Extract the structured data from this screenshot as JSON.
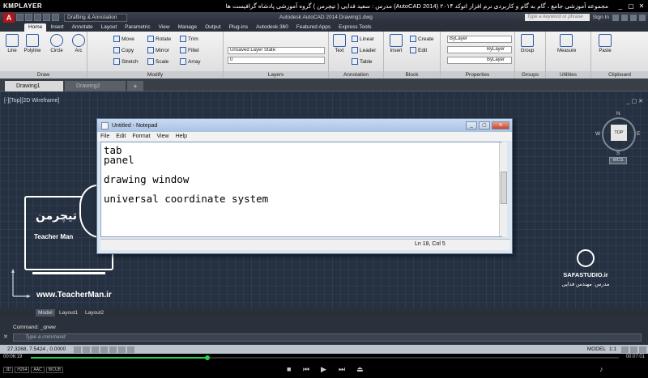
{
  "player": {
    "logo": "KMPLAYER",
    "title": "مجموعه آموزشی جامع ، گام به گام و کاربردی نرم افزار  اتوکد ۲۰۱۴ (AutoCAD 2014)  مدرس : سعید فدایی ( تیچرمن ) گروه آموزشی پادشاه گرافیست ها",
    "controls": [
      "_",
      "▢",
      "✕"
    ],
    "time_current": "00:06:19",
    "time_total": "00:07:01",
    "progress": 0.3,
    "tags": [
      "3D",
      "H264",
      "AAC",
      "BICUB"
    ]
  },
  "autocad": {
    "app_letter": "A",
    "workspace": "Drafting & Annotation",
    "caption": "Autodesk AutoCAD 2014    Drawing1.dwg",
    "search_placeholder": "Type a keyword or phrase",
    "sign_in": "Sign In",
    "ribbon_tabs": [
      "Home",
      "Insert",
      "Annotate",
      "Layout",
      "Parametric",
      "View",
      "Manage",
      "Output",
      "Plug-ins",
      "Autodesk 360",
      "Featured Apps",
      "Express Tools"
    ],
    "active_tab": "Home",
    "panels": {
      "draw": {
        "title": "Draw",
        "tools": [
          "Line",
          "Polyline",
          "Circle",
          "Arc"
        ]
      },
      "modify": {
        "title": "Modify",
        "tools": [
          "Move",
          "Rotate",
          "Trim",
          "Copy",
          "Mirror",
          "Fillet",
          "Stretch",
          "Scale",
          "Array"
        ]
      },
      "layers": {
        "title": "Layers",
        "state": "Unsaved Layer State",
        "current": "0"
      },
      "annotation": {
        "title": "Annotation",
        "tools": [
          "Text",
          "Linear",
          "Leader",
          "Table"
        ]
      },
      "block": {
        "title": "Block",
        "tools": [
          "Insert",
          "Create",
          "Edit"
        ]
      },
      "properties": {
        "title": "Properties",
        "values": [
          "ByLayer",
          "ByLayer",
          "ByLayer"
        ]
      },
      "groups": {
        "title": "Groups",
        "tool": "Group"
      },
      "utilities": {
        "title": "Utilities",
        "tool": "Measure"
      },
      "clipboard": {
        "title": "Clipboard",
        "tool": "Paste"
      }
    },
    "doc_tabs": [
      "Drawing1",
      "Drawing2"
    ],
    "viewport_label": "[-][Top][2D Wireframe]",
    "viewcube": {
      "top": "TOP",
      "n": "N",
      "s": "S",
      "e": "E",
      "w": "W",
      "wcs": "WCS"
    },
    "layout_tabs": [
      "Model",
      "Layout1",
      "Layout2"
    ],
    "command_history": "Command: _qnew",
    "command_placeholder": "Type a command",
    "coords": "27.3268, 7.5424 , 0.0000",
    "model": "MODEL",
    "scale": "1:1"
  },
  "notepad": {
    "title": "Untitled - Notepad",
    "menu": [
      "File",
      "Edit",
      "Format",
      "View",
      "Help"
    ],
    "lines": [
      "tab",
      "panel",
      "",
      "drawing window",
      "",
      "universal coordinate system",
      "",
      "",
      ""
    ],
    "status": "Ln 18, Col 5"
  },
  "overlays": {
    "teacher_fa": "تیچرمن",
    "teacher_name": "Teacher Man",
    "teacher_url": "www.TeacherMan.ir",
    "safa_name": "SAFASTUDIO.ir",
    "safa_sub": "مدرس: مهندس فدایی"
  }
}
